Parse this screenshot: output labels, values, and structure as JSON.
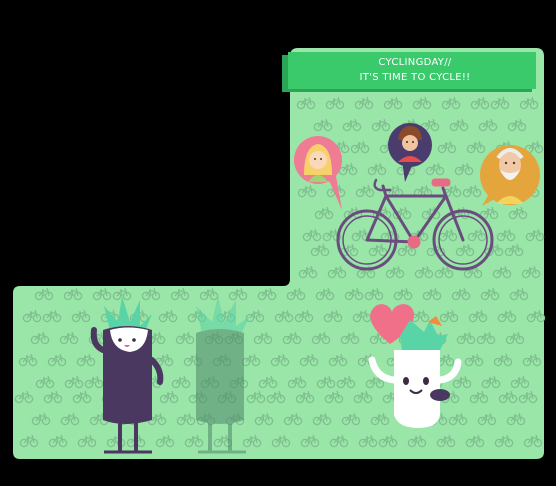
{
  "banner": {
    "line1": "CYCLINGDAY//",
    "line2": "IT'S TIME TO CYCLE!!"
  },
  "colors": {
    "background": "#000000",
    "panel_green": "#9ae5a8",
    "banner_green": "#3ac96b",
    "banner_shadow": "#2aa558",
    "bike_pattern": "#7fbf8f",
    "bicycle_frame": "#6a4c7e",
    "bicycle_accent": "#e96a84",
    "heart": "#f0708a",
    "character_dark": "#4b3860",
    "character_teal": "#59d4a6"
  },
  "icons": {
    "pattern": "bicycle-pattern-icon",
    "main_bike": "bicycle-icon",
    "bubbles": [
      "girl-avatar-icon",
      "boy-avatar-icon",
      "old-man-avatar-icon"
    ],
    "heart": "heart-icon"
  }
}
